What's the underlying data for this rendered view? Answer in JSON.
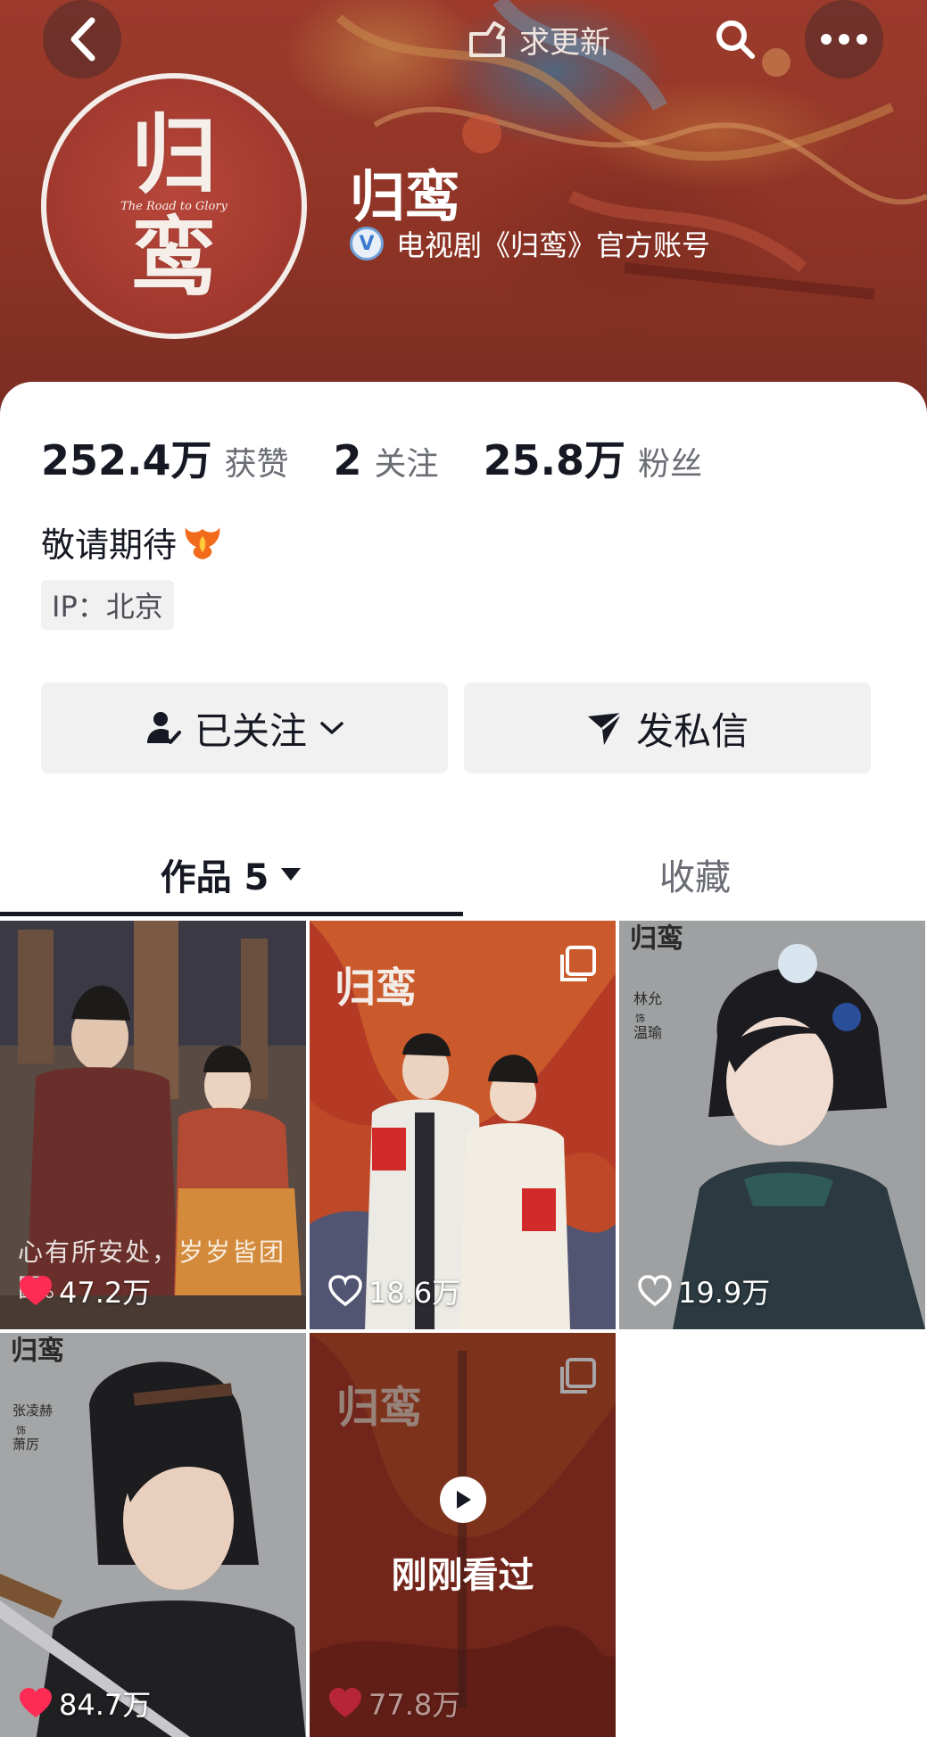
{
  "header": {
    "request_update_label": "求更新"
  },
  "profile": {
    "avatar_glyph_top": "归",
    "avatar_glyph_bottom": "鸾",
    "avatar_subtitle": "The Road to Glory",
    "name": "归鸾",
    "verify_text": "电视剧《归鸾》官方账号"
  },
  "stats": [
    {
      "value": "252.4万",
      "label": "获赞"
    },
    {
      "value": "2",
      "label": "关注"
    },
    {
      "value": "25.8万",
      "label": "粉丝"
    }
  ],
  "bio": "敬请期待",
  "ip_tag": "IP：北京",
  "actions": {
    "followed_label": "已关注",
    "message_label": "发私信"
  },
  "tabs": {
    "works_label": "作品 5",
    "favorites_label": "收藏"
  },
  "grid": {
    "tiles": [
      {
        "likes": "47.2万",
        "liked": true,
        "caption": "心有所安处，岁岁皆团圆。"
      },
      {
        "likes": "18.6万",
        "liked": false,
        "glyph": "归鸾"
      },
      {
        "likes": "19.9万",
        "liked": false,
        "glyph": "归鸾",
        "side_text_1": "林允",
        "side_text_2": "饰",
        "side_text_3": "温瑜"
      },
      {
        "likes": "84.7万",
        "liked": true,
        "glyph": "归鸾",
        "side_text_1": "张凌赫",
        "side_text_2": "饰",
        "side_text_3": "萧厉"
      },
      {
        "likes": "77.8万",
        "liked": true,
        "glyph": "归鸾",
        "watched_label": "刚刚看过"
      }
    ]
  },
  "colors": {
    "banner": "#8e3426",
    "like_red": "#fe2c55",
    "text_primary": "#161823",
    "text_secondary": "#6b6d75",
    "button_bg": "#f1f1f2"
  }
}
